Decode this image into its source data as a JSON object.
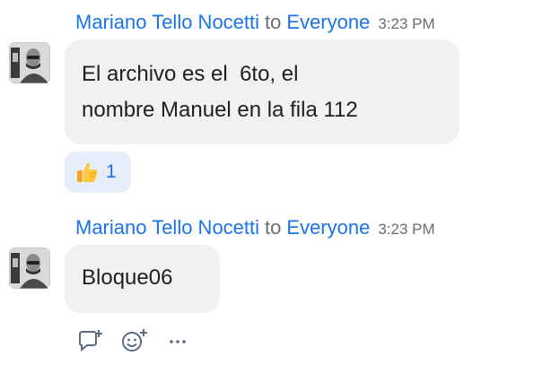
{
  "messages": [
    {
      "sender": "Mariano Tello Nocetti",
      "to_word": "to",
      "recipient": "Everyone",
      "time": "3:23 PM",
      "line1": "El archivo es el  6to, el",
      "line2": "nombre Manuel en la fila 112",
      "reaction": {
        "icon": "thumbs-up-icon",
        "count": "1"
      }
    },
    {
      "sender": "Mariano Tello Nocetti",
      "to_word": "to",
      "recipient": "Everyone",
      "time": "3:23 PM",
      "text": "Bloque06"
    }
  ],
  "actions": [
    {
      "icon": "reply-icon"
    },
    {
      "icon": "add-reaction-icon"
    },
    {
      "icon": "more-options-icon"
    }
  ],
  "colors": {
    "accent": "#1a73e8",
    "bubble": "#f1f1f4",
    "reaction_bg": "#e6eefb",
    "muted": "#6b6b70"
  }
}
